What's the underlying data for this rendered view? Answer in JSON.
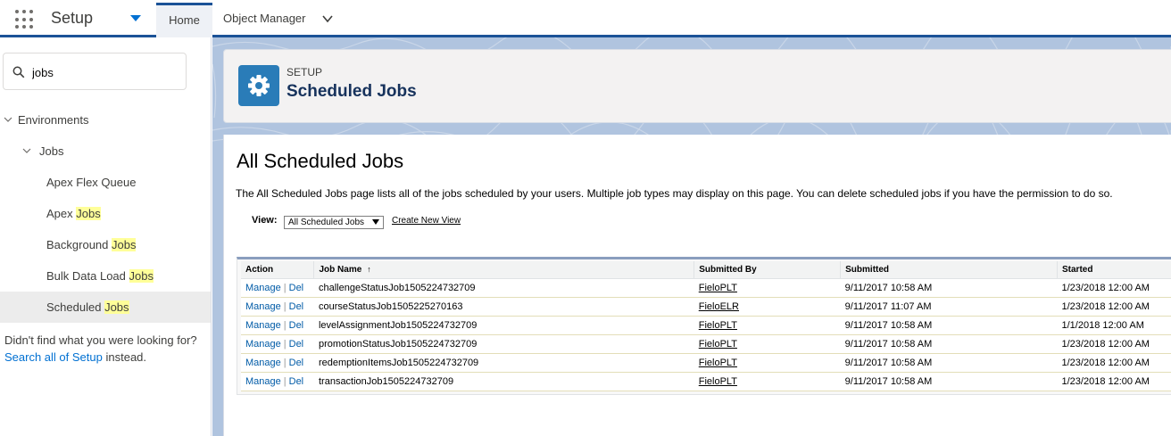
{
  "topbar": {
    "app_name": "Setup",
    "tabs": [
      {
        "label": "Home"
      },
      {
        "label": "Object Manager"
      }
    ]
  },
  "sidebar": {
    "search": {
      "value": "jobs"
    },
    "tree": {
      "environments": "Environments",
      "jobs": "Jobs",
      "items": [
        {
          "pre": "Apex Flex Queue",
          "hl": ""
        },
        {
          "pre": "Apex ",
          "hl": "Jobs"
        },
        {
          "pre": "Background ",
          "hl": "Jobs"
        },
        {
          "pre": "Bulk Data Load ",
          "hl": "Jobs"
        },
        {
          "pre": "Scheduled ",
          "hl": "Jobs"
        }
      ]
    },
    "not_found": {
      "text": "Didn't find what you were looking for?",
      "link": "Search all of Setup",
      "suffix": "instead."
    }
  },
  "header": {
    "eyebrow": "SETUP",
    "title": "Scheduled Jobs"
  },
  "content": {
    "title": "All Scheduled Jobs",
    "description": "The All Scheduled Jobs page lists all of the jobs scheduled by your users. Multiple job types may display on this page. You can delete scheduled jobs if you have the permission to do so.",
    "view_label": "View:",
    "view_selected": "All Scheduled Jobs",
    "create_view": "Create New View"
  },
  "table": {
    "headers": {
      "action": "Action",
      "job_name": "Job Name",
      "submitted_by": "Submitted By",
      "submitted": "Submitted",
      "started": "Started"
    },
    "sort_arrow": "↑",
    "manage": "Manage",
    "sep": "|",
    "del": "Del",
    "rows": [
      {
        "job": "challengeStatusJob1505224732709",
        "by": "FieloPLT",
        "submitted": "9/11/2017 10:58 AM",
        "started": "1/23/2018 12:00 AM"
      },
      {
        "job": "courseStatusJob1505225270163",
        "by": "FieloELR",
        "submitted": "9/11/2017 11:07 AM",
        "started": "1/23/2018 12:00 AM"
      },
      {
        "job": "levelAssignmentJob1505224732709",
        "by": "FieloPLT",
        "submitted": "9/11/2017 10:58 AM",
        "started": "1/1/2018 12:00 AM"
      },
      {
        "job": "promotionStatusJob1505224732709",
        "by": "FieloPLT",
        "submitted": "9/11/2017 10:58 AM",
        "started": "1/23/2018 12:00 AM"
      },
      {
        "job": "redemptionItemsJob1505224732709",
        "by": "FieloPLT",
        "submitted": "9/11/2017 10:58 AM",
        "started": "1/23/2018 12:00 AM"
      },
      {
        "job": "transactionJob1505224732709",
        "by": "FieloPLT",
        "submitted": "9/11/2017 10:58 AM",
        "started": "1/23/2018 12:00 AM"
      }
    ]
  }
}
